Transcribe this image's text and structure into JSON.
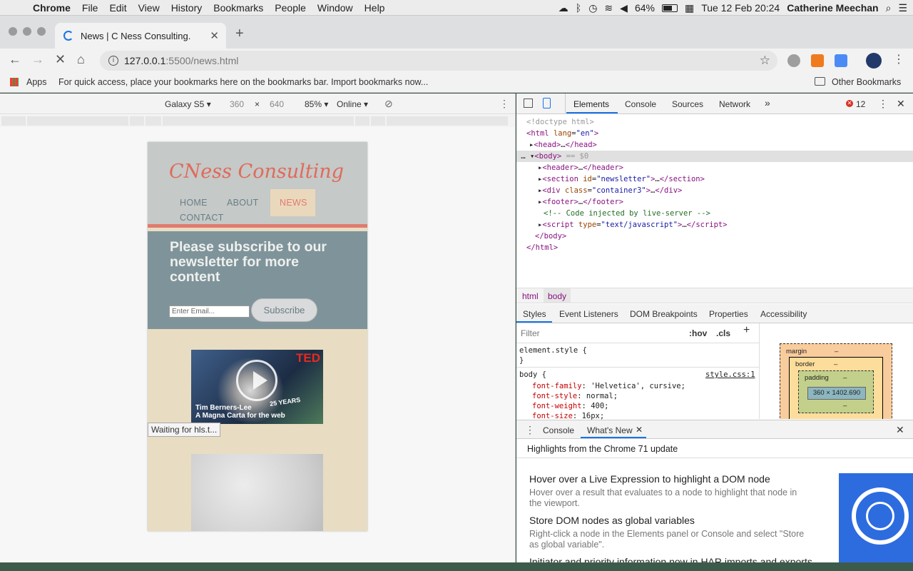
{
  "menubar": {
    "app": "Chrome",
    "items": [
      "File",
      "Edit",
      "View",
      "History",
      "Bookmarks",
      "People",
      "Window",
      "Help"
    ],
    "battery": "64%",
    "datetime": "Tue 12 Feb  20:24",
    "user": "Catherine Meechan"
  },
  "tab": {
    "title": "News | C Ness Consulting."
  },
  "omnibox": {
    "host": "127.0.0.1",
    "rest": ":5500/news.html"
  },
  "bookmarks": {
    "apps": "Apps",
    "hint": "For quick access, place your bookmarks here on the bookmarks bar. Import bookmarks now...",
    "other": "Other Bookmarks"
  },
  "device": {
    "name": "Galaxy S5",
    "width": "360",
    "x": "×",
    "height": "640",
    "zoom": "85%",
    "network": "Online"
  },
  "site": {
    "logo": "CNess Consulting",
    "nav": [
      "HOME",
      "ABOUT",
      "NEWS",
      "CONTACT"
    ],
    "headline": "Please subscribe to our newsletter for more content",
    "email_placeholder": "Enter Email...",
    "subscribe": "Subscribe",
    "video_brand": "TED",
    "video_caption1": "Tim Berners-Lee",
    "video_caption2": "A Magna Carta for the web",
    "video_badge": "25 YEARS"
  },
  "status": {
    "waiting": "Waiting for hls.t..."
  },
  "devtools": {
    "tabs": [
      "Elements",
      "Console",
      "Sources",
      "Network"
    ],
    "more": "»",
    "errors": "12",
    "crumbs": [
      "html",
      "body"
    ],
    "subtabs": [
      "Styles",
      "Event Listeners",
      "DOM Breakpoints",
      "Properties",
      "Accessibility"
    ],
    "filter": "Filter",
    "hov": ":hov",
    "cls": ".cls",
    "styles": {
      "element": "element.style {",
      "close": "}",
      "body_sel": "body {",
      "source": "style.css:1",
      "props": [
        [
          "font-family",
          "'Helvetica', cursive;"
        ],
        [
          "font-style",
          "normal;"
        ],
        [
          "font-weight",
          "400;"
        ],
        [
          "font-size",
          "16px;"
        ]
      ]
    },
    "boxmodel": {
      "margin": "margin",
      "border": "border",
      "padding": "padding",
      "content": "360 × 1402.690",
      "dash": "–"
    },
    "drawer": {
      "tabs": [
        "Console",
        "What's New"
      ],
      "highlights": "Highlights from the Chrome 71 update",
      "items": [
        {
          "title": "Hover over a Live Expression to highlight a DOM node",
          "desc": "Hover over a result that evaluates to a node to highlight that node in the viewport."
        },
        {
          "title": "Store DOM nodes as global variables",
          "desc": "Right-click a node in the Elements panel or Console and select \"Store as global variable\"."
        },
        {
          "title": "Initiator and priority information now in HAR imports and exports",
          "desc": ""
        }
      ]
    }
  }
}
